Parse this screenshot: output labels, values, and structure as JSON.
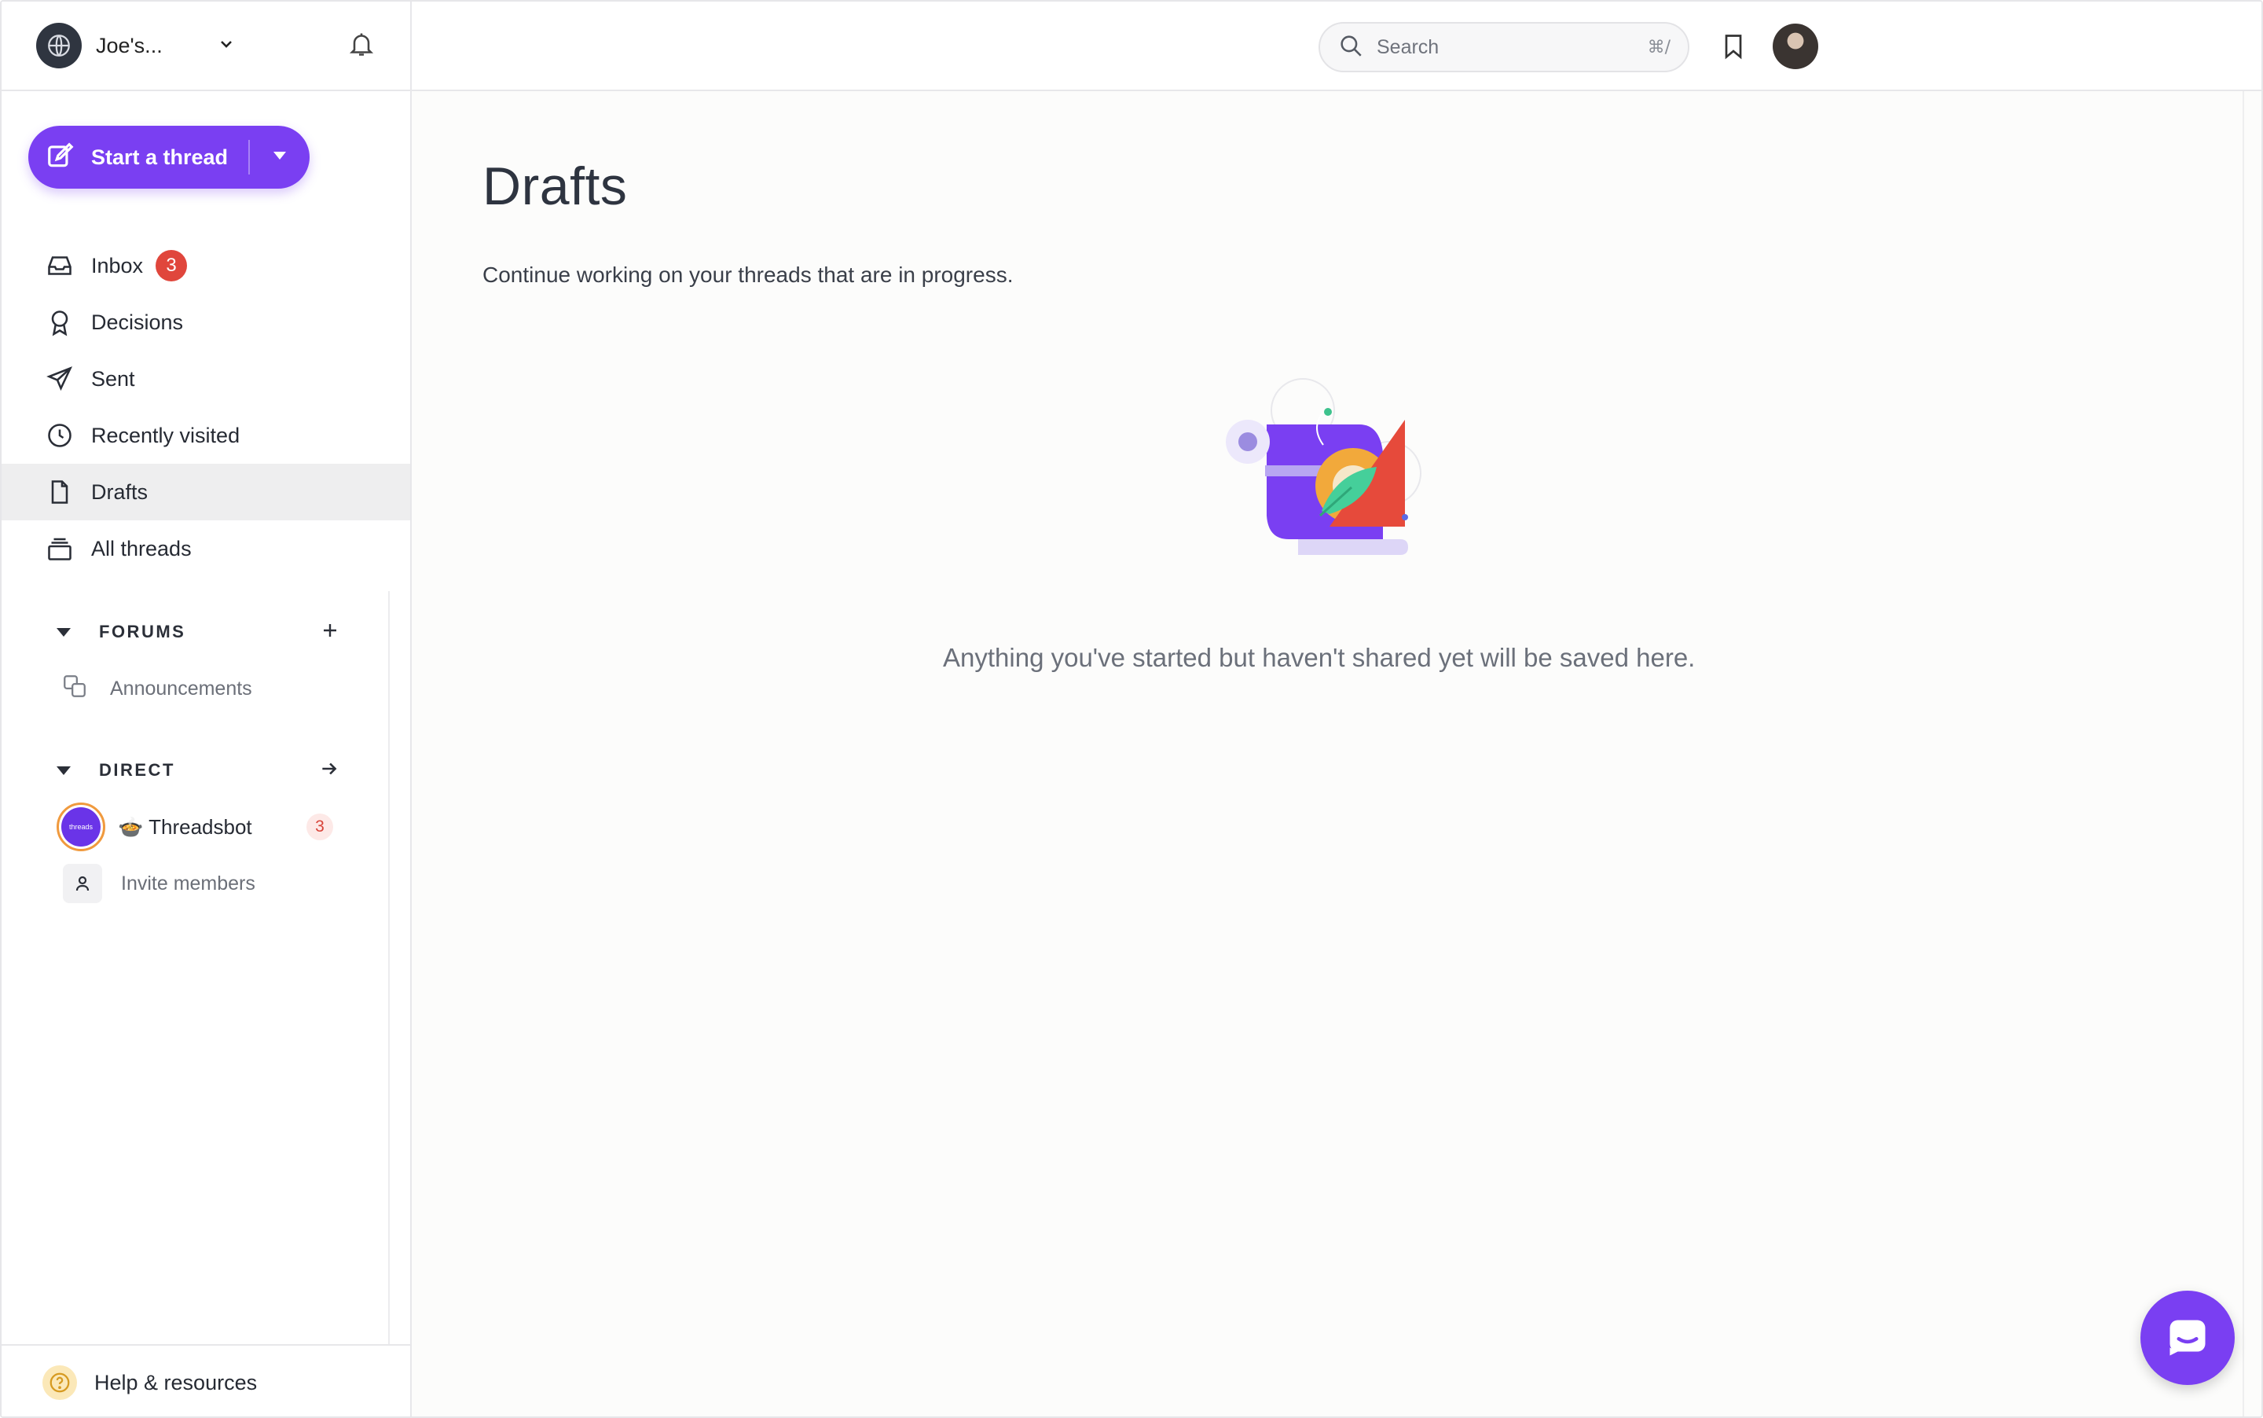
{
  "workspace": {
    "name": "Joe's..."
  },
  "sidebar": {
    "start_thread_label": "Start a thread",
    "nav": [
      {
        "label": "Inbox",
        "icon": "inbox-icon",
        "badge": "3"
      },
      {
        "label": "Decisions",
        "icon": "ribbon-icon"
      },
      {
        "label": "Sent",
        "icon": "send-icon"
      },
      {
        "label": "Recently visited",
        "icon": "clock-icon"
      },
      {
        "label": "Drafts",
        "icon": "file-icon",
        "active": true
      },
      {
        "label": "All threads",
        "icon": "stack-icon"
      }
    ],
    "forums": {
      "title": "FORUMS",
      "items": [
        {
          "label": "Announcements"
        }
      ]
    },
    "direct": {
      "title": "DIRECT",
      "bot": {
        "avatar_text": "threads",
        "label": "🍲 Threadsbot",
        "count": "3"
      },
      "invite_label": "Invite members"
    },
    "help_label": "Help & resources"
  },
  "topbar": {
    "search_placeholder": "Search",
    "search_shortcut": "⌘/"
  },
  "main": {
    "title": "Drafts",
    "subtitle": "Continue working on your threads that are in progress.",
    "empty_message": "Anything you've started but haven't shared yet will be saved here."
  },
  "colors": {
    "accent": "#7a3ff2",
    "badge": "#e0463c",
    "active_nav": "#eeeeef"
  }
}
